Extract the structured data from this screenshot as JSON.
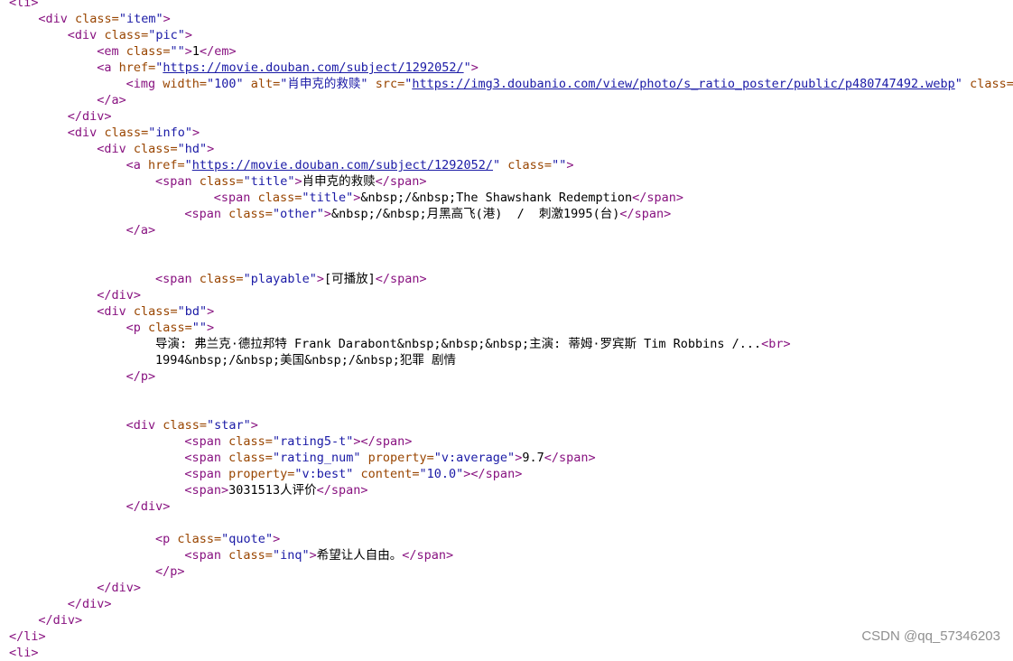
{
  "colors": {
    "tag": "#881280",
    "attr": "#994500",
    "value": "#1a1aa6",
    "text": "#000000",
    "watermark": "#8f8f8f"
  },
  "watermark": "CSDN @qq_57346203",
  "lines": [
    {
      "indent": 0,
      "tokens": [
        {
          "t": "tag",
          "v": "<li>"
        }
      ]
    },
    {
      "indent": 4,
      "tokens": [
        {
          "t": "tag",
          "v": "<div "
        },
        {
          "t": "attr",
          "v": "class="
        },
        {
          "t": "value",
          "v": "\"item\""
        },
        {
          "t": "tag",
          "v": ">"
        }
      ]
    },
    {
      "indent": 8,
      "tokens": [
        {
          "t": "tag",
          "v": "<div "
        },
        {
          "t": "attr",
          "v": "class="
        },
        {
          "t": "value",
          "v": "\"pic\""
        },
        {
          "t": "tag",
          "v": ">"
        }
      ]
    },
    {
      "indent": 12,
      "tokens": [
        {
          "t": "tag",
          "v": "<em "
        },
        {
          "t": "attr",
          "v": "class="
        },
        {
          "t": "value",
          "v": "\"\""
        },
        {
          "t": "tag",
          "v": ">"
        },
        {
          "t": "text",
          "v": "1"
        },
        {
          "t": "tag",
          "v": "</em>"
        }
      ]
    },
    {
      "indent": 12,
      "tokens": [
        {
          "t": "tag",
          "v": "<a "
        },
        {
          "t": "attr",
          "v": "href="
        },
        {
          "t": "value",
          "v": "\""
        },
        {
          "t": "link",
          "v": "https://movie.douban.com/subject/1292052/"
        },
        {
          "t": "value",
          "v": "\""
        },
        {
          "t": "tag",
          "v": ">"
        }
      ]
    },
    {
      "indent": 16,
      "tokens": [
        {
          "t": "tag",
          "v": "<img "
        },
        {
          "t": "attr",
          "v": "width="
        },
        {
          "t": "value",
          "v": "\"100\""
        },
        {
          "t": "attr",
          "v": " alt="
        },
        {
          "t": "value",
          "v": "\"肖申克的救赎\""
        },
        {
          "t": "attr",
          "v": " src="
        },
        {
          "t": "value",
          "v": "\""
        },
        {
          "t": "link",
          "v": "https://img3.doubanio.com/view/photo/s_ratio_poster/public/p480747492.webp"
        },
        {
          "t": "value",
          "v": "\""
        },
        {
          "t": "attr",
          "v": " class="
        }
      ]
    },
    {
      "indent": 12,
      "tokens": [
        {
          "t": "tag",
          "v": "</a>"
        }
      ]
    },
    {
      "indent": 8,
      "tokens": [
        {
          "t": "tag",
          "v": "</div>"
        }
      ]
    },
    {
      "indent": 8,
      "tokens": [
        {
          "t": "tag",
          "v": "<div "
        },
        {
          "t": "attr",
          "v": "class="
        },
        {
          "t": "value",
          "v": "\"info\""
        },
        {
          "t": "tag",
          "v": ">"
        }
      ]
    },
    {
      "indent": 12,
      "tokens": [
        {
          "t": "tag",
          "v": "<div "
        },
        {
          "t": "attr",
          "v": "class="
        },
        {
          "t": "value",
          "v": "\"hd\""
        },
        {
          "t": "tag",
          "v": ">"
        }
      ]
    },
    {
      "indent": 16,
      "tokens": [
        {
          "t": "tag",
          "v": "<a "
        },
        {
          "t": "attr",
          "v": "href="
        },
        {
          "t": "value",
          "v": "\""
        },
        {
          "t": "link",
          "v": "https://movie.douban.com/subject/1292052/"
        },
        {
          "t": "value",
          "v": "\""
        },
        {
          "t": "attr",
          "v": " class="
        },
        {
          "t": "value",
          "v": "\"\""
        },
        {
          "t": "tag",
          "v": ">"
        }
      ]
    },
    {
      "indent": 20,
      "tokens": [
        {
          "t": "tag",
          "v": "<span "
        },
        {
          "t": "attr",
          "v": "class="
        },
        {
          "t": "value",
          "v": "\"title\""
        },
        {
          "t": "tag",
          "v": ">"
        },
        {
          "t": "text",
          "v": "肖申克的救赎"
        },
        {
          "t": "tag",
          "v": "</span>"
        }
      ]
    },
    {
      "indent": 28,
      "tokens": [
        {
          "t": "tag",
          "v": "<span "
        },
        {
          "t": "attr",
          "v": "class="
        },
        {
          "t": "value",
          "v": "\"title\""
        },
        {
          "t": "tag",
          "v": ">"
        },
        {
          "t": "text",
          "v": "&nbsp;/&nbsp;The Shawshank Redemption"
        },
        {
          "t": "tag",
          "v": "</span>"
        }
      ]
    },
    {
      "indent": 24,
      "tokens": [
        {
          "t": "tag",
          "v": "<span "
        },
        {
          "t": "attr",
          "v": "class="
        },
        {
          "t": "value",
          "v": "\"other\""
        },
        {
          "t": "tag",
          "v": ">"
        },
        {
          "t": "text",
          "v": "&nbsp;/&nbsp;月黑高飞(港)  /  刺激1995(台)"
        },
        {
          "t": "tag",
          "v": "</span>"
        }
      ]
    },
    {
      "indent": 16,
      "tokens": [
        {
          "t": "tag",
          "v": "</a>"
        }
      ]
    },
    {
      "indent": 0,
      "tokens": []
    },
    {
      "indent": 0,
      "tokens": []
    },
    {
      "indent": 20,
      "tokens": [
        {
          "t": "tag",
          "v": "<span "
        },
        {
          "t": "attr",
          "v": "class="
        },
        {
          "t": "value",
          "v": "\"playable\""
        },
        {
          "t": "tag",
          "v": ">"
        },
        {
          "t": "text",
          "v": "[可播放]"
        },
        {
          "t": "tag",
          "v": "</span>"
        }
      ]
    },
    {
      "indent": 12,
      "tokens": [
        {
          "t": "tag",
          "v": "</div>"
        }
      ]
    },
    {
      "indent": 12,
      "tokens": [
        {
          "t": "tag",
          "v": "<div "
        },
        {
          "t": "attr",
          "v": "class="
        },
        {
          "t": "value",
          "v": "\"bd\""
        },
        {
          "t": "tag",
          "v": ">"
        }
      ]
    },
    {
      "indent": 16,
      "tokens": [
        {
          "t": "tag",
          "v": "<p "
        },
        {
          "t": "attr",
          "v": "class="
        },
        {
          "t": "value",
          "v": "\"\""
        },
        {
          "t": "tag",
          "v": ">"
        }
      ]
    },
    {
      "indent": 20,
      "tokens": [
        {
          "t": "text",
          "v": "导演: 弗兰克·德拉邦特 Frank Darabont&nbsp;&nbsp;&nbsp;主演: 蒂姆·罗宾斯 Tim Robbins /..."
        },
        {
          "t": "tag",
          "v": "<br>"
        }
      ]
    },
    {
      "indent": 20,
      "tokens": [
        {
          "t": "text",
          "v": "1994&nbsp;/&nbsp;美国&nbsp;/&nbsp;犯罪 剧情"
        }
      ]
    },
    {
      "indent": 16,
      "tokens": [
        {
          "t": "tag",
          "v": "</p>"
        }
      ]
    },
    {
      "indent": 0,
      "tokens": []
    },
    {
      "indent": 0,
      "tokens": []
    },
    {
      "indent": 16,
      "tokens": [
        {
          "t": "tag",
          "v": "<div "
        },
        {
          "t": "attr",
          "v": "class="
        },
        {
          "t": "value",
          "v": "\"star\""
        },
        {
          "t": "tag",
          "v": ">"
        }
      ]
    },
    {
      "indent": 24,
      "tokens": [
        {
          "t": "tag",
          "v": "<span "
        },
        {
          "t": "attr",
          "v": "class="
        },
        {
          "t": "value",
          "v": "\"rating5-t\""
        },
        {
          "t": "tag",
          "v": "></span>"
        }
      ]
    },
    {
      "indent": 24,
      "tokens": [
        {
          "t": "tag",
          "v": "<span "
        },
        {
          "t": "attr",
          "v": "class="
        },
        {
          "t": "value",
          "v": "\"rating_num\""
        },
        {
          "t": "attr",
          "v": " property="
        },
        {
          "t": "value",
          "v": "\"v:average\""
        },
        {
          "t": "tag",
          "v": ">"
        },
        {
          "t": "text",
          "v": "9.7"
        },
        {
          "t": "tag",
          "v": "</span>"
        }
      ]
    },
    {
      "indent": 24,
      "tokens": [
        {
          "t": "tag",
          "v": "<span "
        },
        {
          "t": "attr",
          "v": "property="
        },
        {
          "t": "value",
          "v": "\"v:best\""
        },
        {
          "t": "attr",
          "v": " content="
        },
        {
          "t": "value",
          "v": "\"10.0\""
        },
        {
          "t": "tag",
          "v": "></span>"
        }
      ]
    },
    {
      "indent": 24,
      "tokens": [
        {
          "t": "tag",
          "v": "<span>"
        },
        {
          "t": "text",
          "v": "3031513人评价"
        },
        {
          "t": "tag",
          "v": "</span>"
        }
      ]
    },
    {
      "indent": 16,
      "tokens": [
        {
          "t": "tag",
          "v": "</div>"
        }
      ]
    },
    {
      "indent": 0,
      "tokens": []
    },
    {
      "indent": 20,
      "tokens": [
        {
          "t": "tag",
          "v": "<p "
        },
        {
          "t": "attr",
          "v": "class="
        },
        {
          "t": "value",
          "v": "\"quote\""
        },
        {
          "t": "tag",
          "v": ">"
        }
      ]
    },
    {
      "indent": 24,
      "tokens": [
        {
          "t": "tag",
          "v": "<span "
        },
        {
          "t": "attr",
          "v": "class="
        },
        {
          "t": "value",
          "v": "\"inq\""
        },
        {
          "t": "tag",
          "v": ">"
        },
        {
          "t": "text",
          "v": "希望让人自由。"
        },
        {
          "t": "tag",
          "v": "</span>"
        }
      ]
    },
    {
      "indent": 20,
      "tokens": [
        {
          "t": "tag",
          "v": "</p>"
        }
      ]
    },
    {
      "indent": 12,
      "tokens": [
        {
          "t": "tag",
          "v": "</div>"
        }
      ]
    },
    {
      "indent": 8,
      "tokens": [
        {
          "t": "tag",
          "v": "</div>"
        }
      ]
    },
    {
      "indent": 4,
      "tokens": [
        {
          "t": "tag",
          "v": "</div>"
        }
      ]
    },
    {
      "indent": 0,
      "tokens": [
        {
          "t": "tag",
          "v": "</li>"
        }
      ]
    },
    {
      "indent": 0,
      "tokens": [
        {
          "t": "tag",
          "v": "<li>"
        }
      ]
    }
  ]
}
